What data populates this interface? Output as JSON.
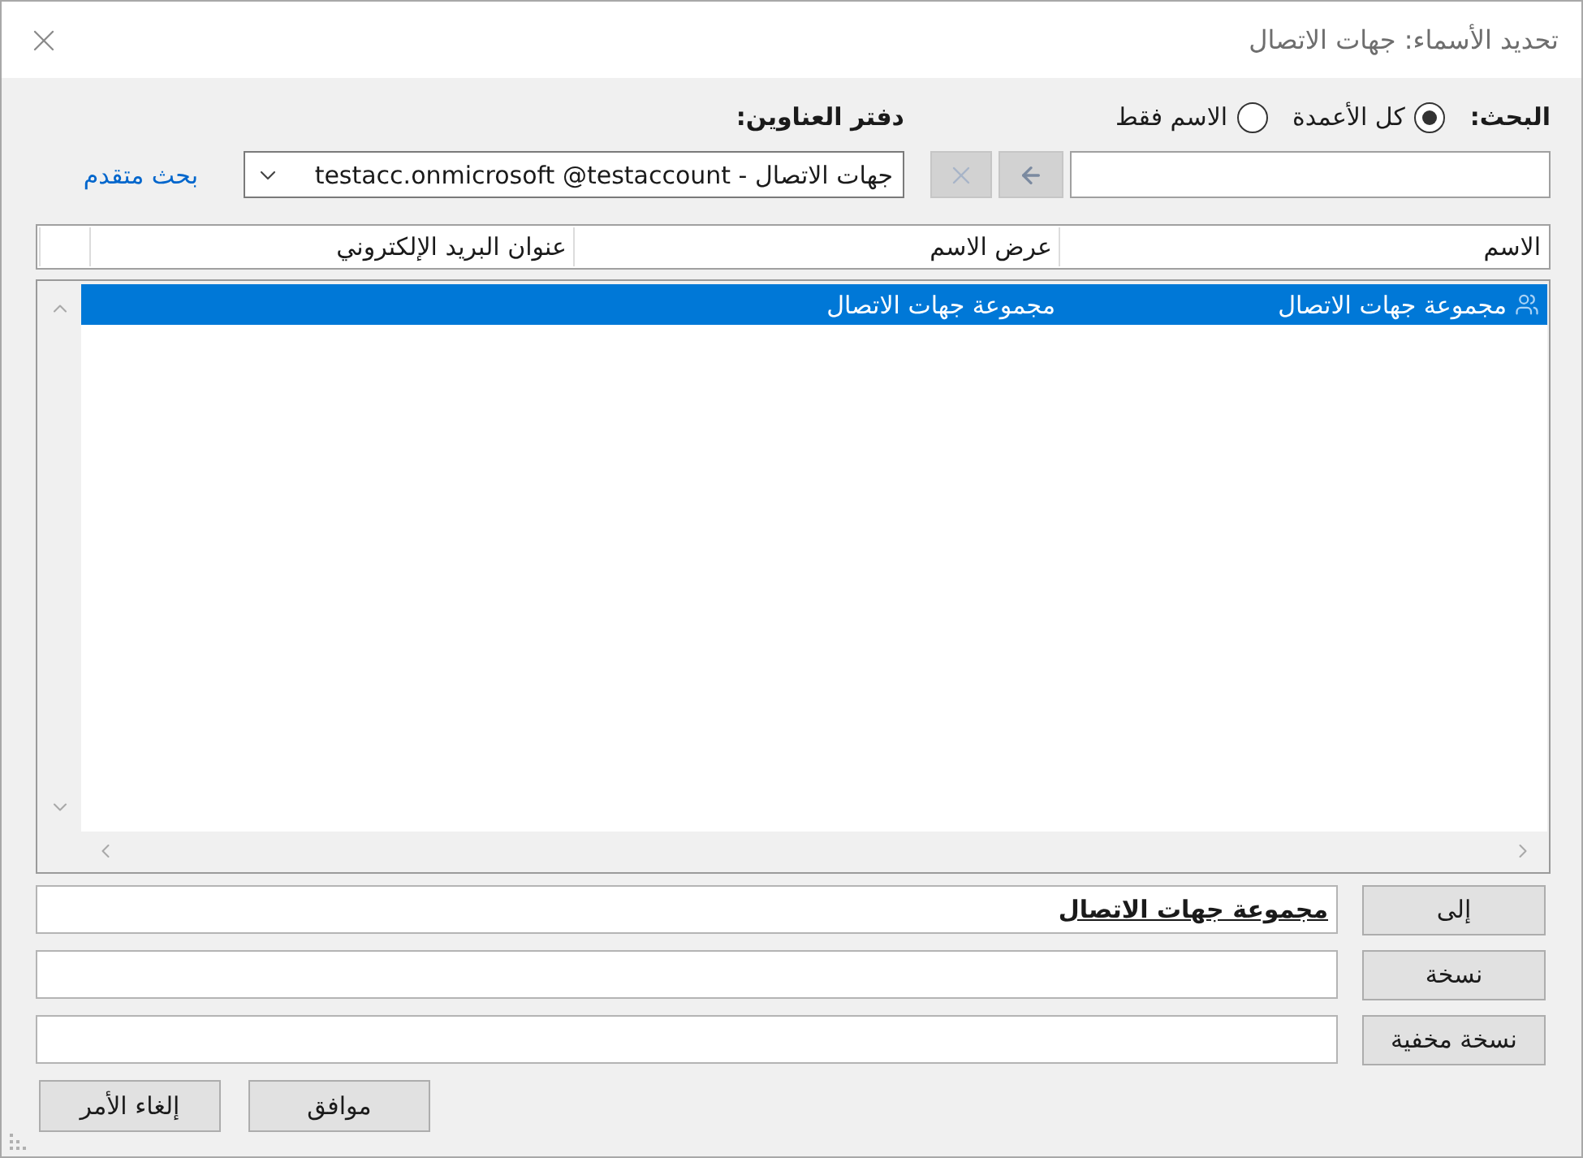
{
  "window": {
    "title": "تحديد الأسماء: جهات الاتصال"
  },
  "search": {
    "label": "البحث:",
    "options": [
      {
        "label": "كل الأعمدة",
        "selected": true
      },
      {
        "label": "الاسم فقط",
        "selected": false
      }
    ]
  },
  "address_book": {
    "label": "دفتر العناوين:",
    "value": "جهات الاتصال - testacc.onmicrosoft @testaccount"
  },
  "advanced_search": {
    "label": "بحث متقدم"
  },
  "table": {
    "columns": [
      "الاسم",
      "عرض الاسم",
      "عنوان البريد الإلكتروني"
    ],
    "rows": [
      {
        "kind": "group",
        "name": "مجموعة جهات الاتصال",
        "display_name": "مجموعة جهات الاتصال",
        "selected": true
      }
    ]
  },
  "recipients": [
    {
      "label": "إلى",
      "value": "مجموعة جهات الاتصال",
      "resolved": true
    },
    {
      "label": "نسخة"
    },
    {
      "label": "نسخة مخفية"
    }
  ],
  "buttons": [
    {
      "label": "موافق"
    },
    {
      "label": "إلغاء الأمر"
    }
  ]
}
